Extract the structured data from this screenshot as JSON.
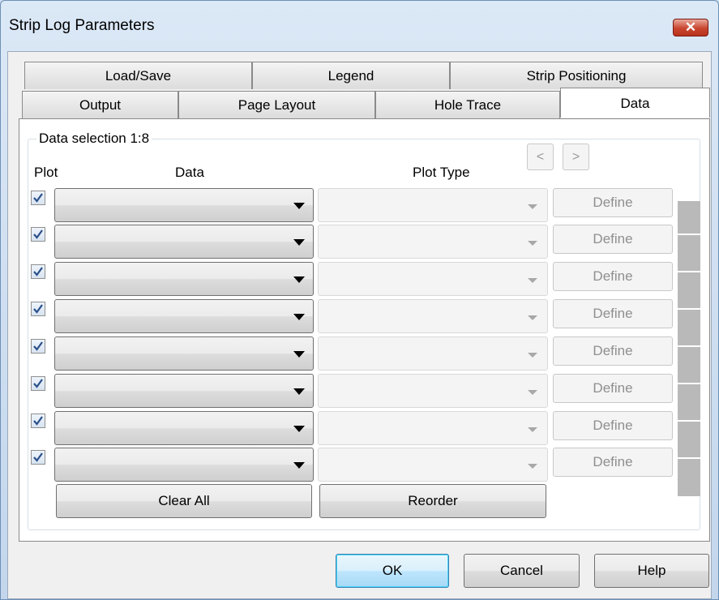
{
  "window": {
    "title": "Strip Log Parameters",
    "close_label": "✕"
  },
  "tabs": {
    "back_row": [
      "Load/Save",
      "Legend",
      "Strip Positioning"
    ],
    "front_row": [
      "Output",
      "Page Layout",
      "Hole Trace",
      "Data"
    ],
    "active": "Data"
  },
  "data_tab": {
    "group_label": "Data selection 1:8",
    "col_plot": "Plot",
    "col_data": "Data",
    "col_plot_type": "Plot Type",
    "prev_label": "<",
    "next_label": ">",
    "rows": [
      {
        "checked": true,
        "data": "",
        "plot_type": "",
        "define_label": "Define"
      },
      {
        "checked": true,
        "data": "",
        "plot_type": "",
        "define_label": "Define"
      },
      {
        "checked": true,
        "data": "",
        "plot_type": "",
        "define_label": "Define"
      },
      {
        "checked": true,
        "data": "",
        "plot_type": "",
        "define_label": "Define"
      },
      {
        "checked": true,
        "data": "",
        "plot_type": "",
        "define_label": "Define"
      },
      {
        "checked": true,
        "data": "",
        "plot_type": "",
        "define_label": "Define"
      },
      {
        "checked": true,
        "data": "",
        "plot_type": "",
        "define_label": "Define"
      },
      {
        "checked": true,
        "data": "",
        "plot_type": "",
        "define_label": "Define"
      }
    ],
    "clear_all_label": "Clear All",
    "reorder_label": "Reorder"
  },
  "footer": {
    "ok_label": "OK",
    "cancel_label": "Cancel",
    "help_label": "Help"
  },
  "colors": {
    "title_bg": "#cfe0f1",
    "close": "#c9452f",
    "default_button": "#3c7fb1",
    "checkbox_check": "#2a4f8a"
  }
}
